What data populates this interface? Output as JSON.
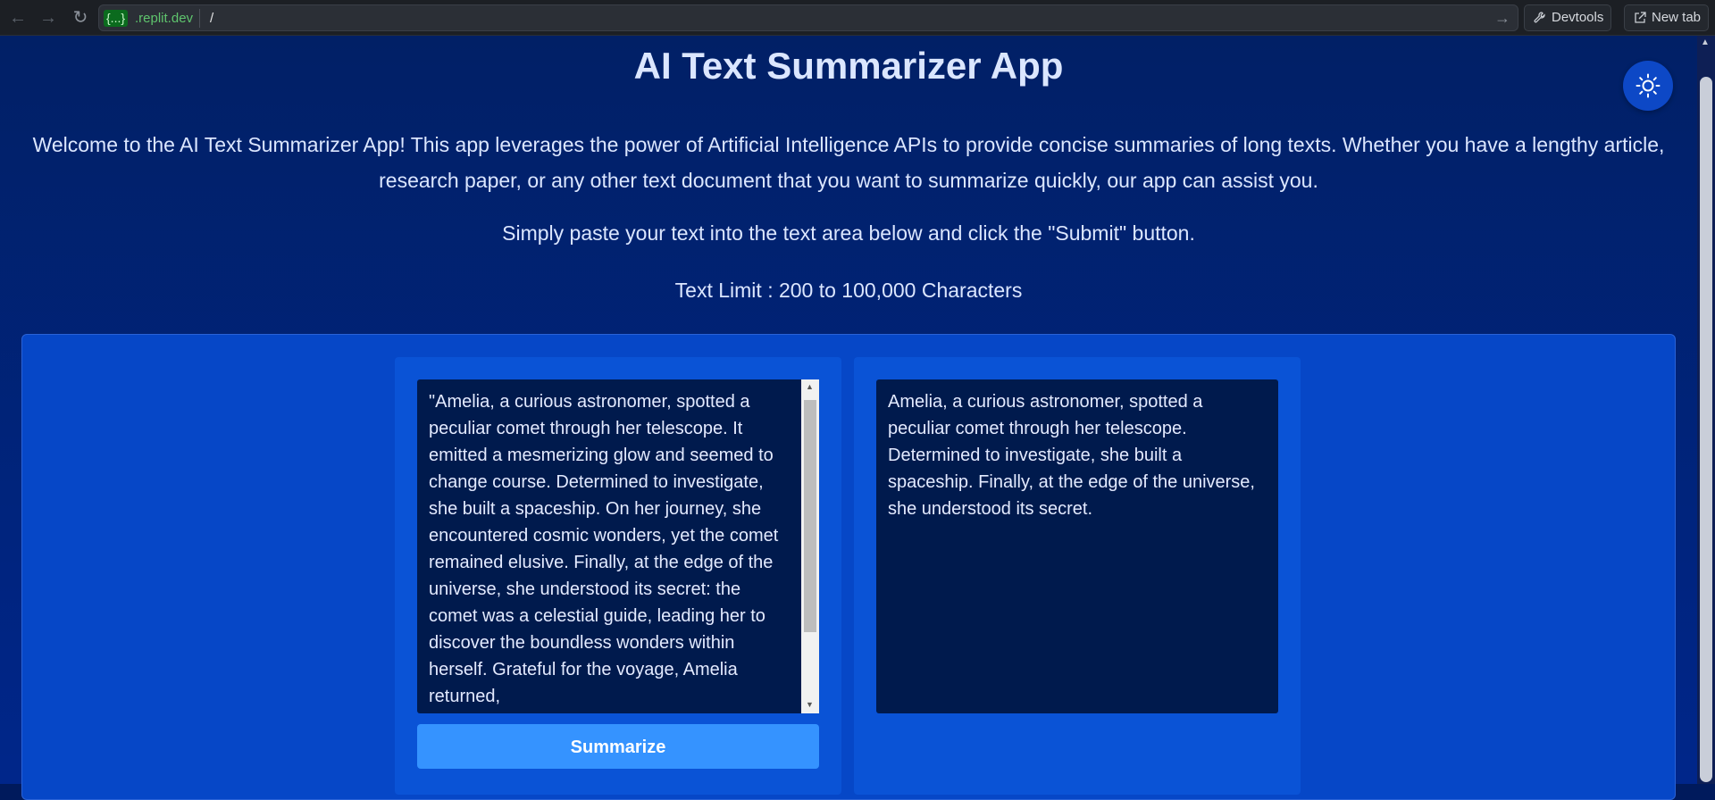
{
  "browser": {
    "url_host_badge": "{...}",
    "url_host_rest": ".replit.dev",
    "url_path": "/",
    "devtools_label": "Devtools",
    "new_tab_label": "New tab"
  },
  "header": {
    "title": "AI Text Summarizer App",
    "theme_toggle_icon": "sun-icon"
  },
  "content": {
    "intro": "Welcome to the AI Text Summarizer App! This app leverages the power of Artificial Intelligence APIs to provide concise summaries of long texts. Whether you have a lengthy article, research paper, or any other text document that you want to summarize quickly, our app can assist you.",
    "instructions": "Simply paste your text into the text area below and click the \"Submit\" button.",
    "limit": "Text Limit : 200 to 100,000 Characters"
  },
  "input": {
    "text": "\"Amelia, a curious astronomer, spotted a peculiar comet through her telescope. It emitted a mesmerizing glow and seemed to change course. Determined to investigate, she built a spaceship. On her journey, she encountered cosmic wonders, yet the comet remained elusive. Finally, at the edge of the universe, she understood its secret: the comet was a celestial guide, leading her to discover the boundless wonders within herself. Grateful for the voyage, Amelia returned,"
  },
  "output": {
    "text": "Amelia, a curious astronomer, spotted a peculiar comet through her telescope. Determined to investigate, she built a spaceship. Finally, at the edge of the universe, she understood its secret."
  },
  "actions": {
    "summarize_label": "Summarize"
  },
  "colors": {
    "page_bg": "#012066",
    "panel_bg": "#0647c7",
    "textbox_bg": "#001a4d",
    "button_bg": "#3593ff",
    "text": "#dbe6ff"
  }
}
